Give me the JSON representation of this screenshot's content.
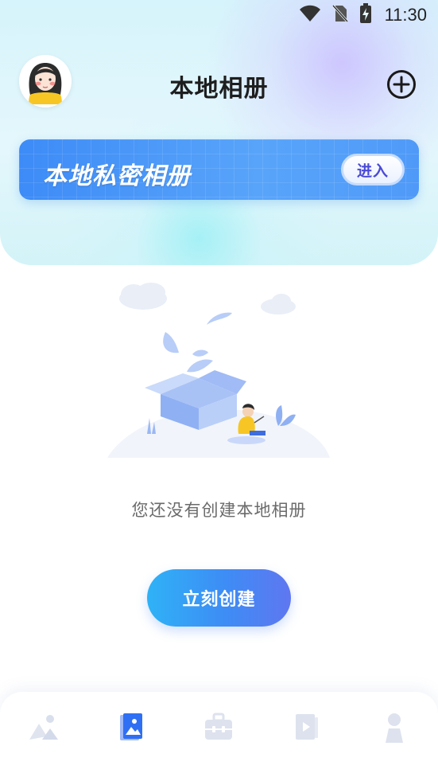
{
  "status_bar": {
    "time": "11:30",
    "icons": [
      "wifi-icon",
      "no-sim-icon",
      "battery-charging-icon"
    ]
  },
  "header": {
    "title": "本地相册",
    "avatar_icon": "avatar",
    "add_icon": "add-circle-icon"
  },
  "banner": {
    "title": "本地私密相册",
    "button_label": "进入"
  },
  "empty_state": {
    "message": "您还没有创建本地相册",
    "illustration": "empty-box-illustration"
  },
  "create_button": {
    "label": "立刻创建"
  },
  "bottom_nav": {
    "items": [
      {
        "icon": "photos-icon",
        "active": false
      },
      {
        "icon": "album-icon",
        "active": true
      },
      {
        "icon": "toolbox-icon",
        "active": false
      },
      {
        "icon": "video-icon",
        "active": false
      },
      {
        "icon": "profile-icon",
        "active": false
      }
    ]
  },
  "colors": {
    "accent": "#3e8cf5",
    "banner": "#4f9af8",
    "nav_inactive": "#dde2ee",
    "nav_active": "#2f6ff3"
  }
}
